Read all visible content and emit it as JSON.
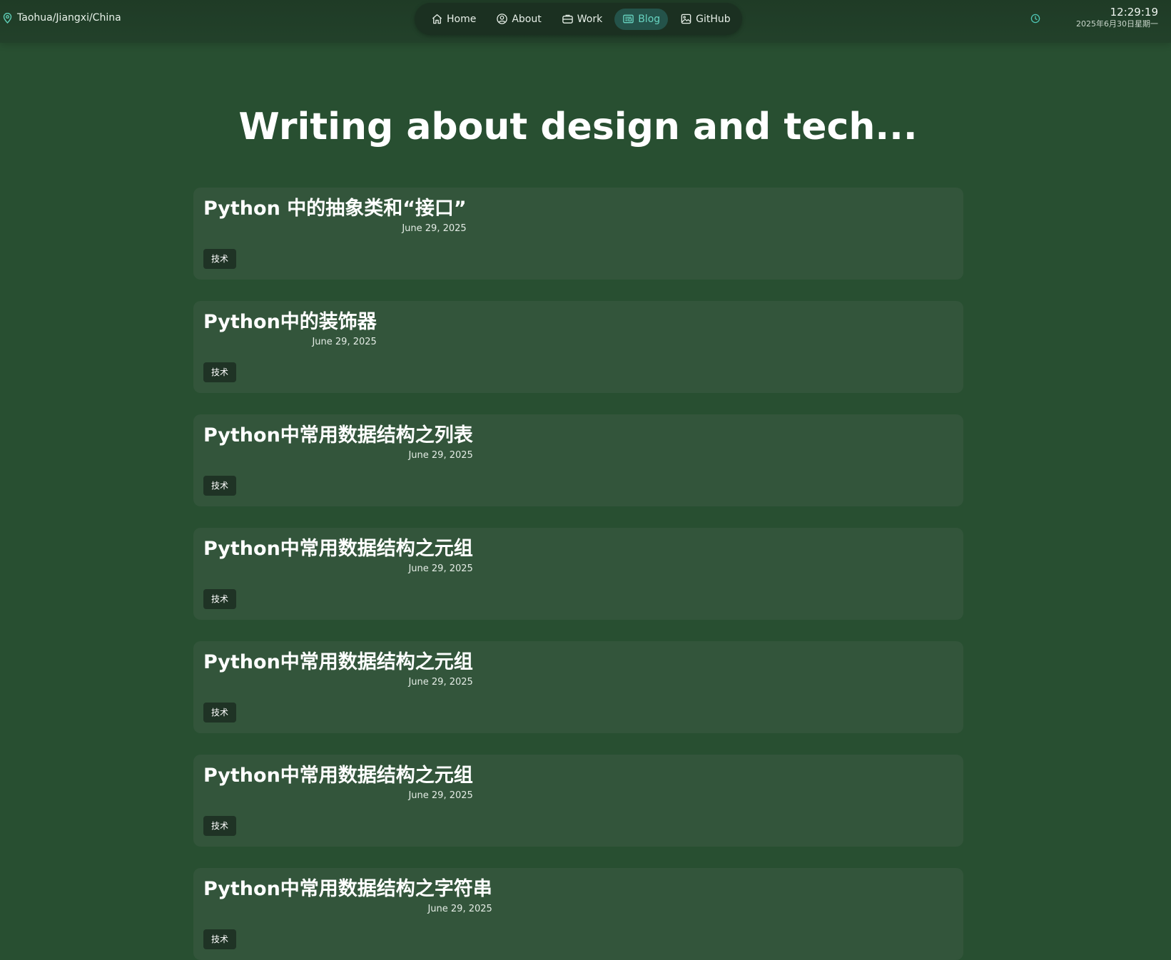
{
  "header": {
    "location": "Taohua/Jiangxi/China",
    "nav": [
      {
        "label": "Home",
        "icon": "home-icon"
      },
      {
        "label": "About",
        "icon": "user-circle-icon"
      },
      {
        "label": "Work",
        "icon": "briefcase-icon"
      },
      {
        "label": "Blog",
        "icon": "newspaper-icon",
        "active": true
      },
      {
        "label": "GitHub",
        "icon": "image-icon"
      }
    ],
    "time": "12:29:19",
    "date": "2025年6月30日星期一"
  },
  "main": {
    "title": "Writing about design and tech..."
  },
  "posts": [
    {
      "title": "Python 中的抽象类和“接口”",
      "date": "June 29, 2025",
      "tag": "技术"
    },
    {
      "title": "Python中的装饰器",
      "date": "June 29, 2025",
      "tag": "技术"
    },
    {
      "title": "Python中常用数据结构之列表",
      "date": "June 29, 2025",
      "tag": "技术"
    },
    {
      "title": "Python中常用数据结构之元组",
      "date": "June 29, 2025",
      "tag": "技术"
    },
    {
      "title": "Python中常用数据结构之元组",
      "date": "June 29, 2025",
      "tag": "技术"
    },
    {
      "title": "Python中常用数据结构之元组",
      "date": "June 29, 2025",
      "tag": "技术"
    },
    {
      "title": "Python中常用数据结构之字符串",
      "date": "June 29, 2025",
      "tag": "技术"
    }
  ],
  "colors": {
    "background": "#284f31",
    "card": "#33553b",
    "accent": "#67d3c0",
    "tag": "#1f3325"
  }
}
